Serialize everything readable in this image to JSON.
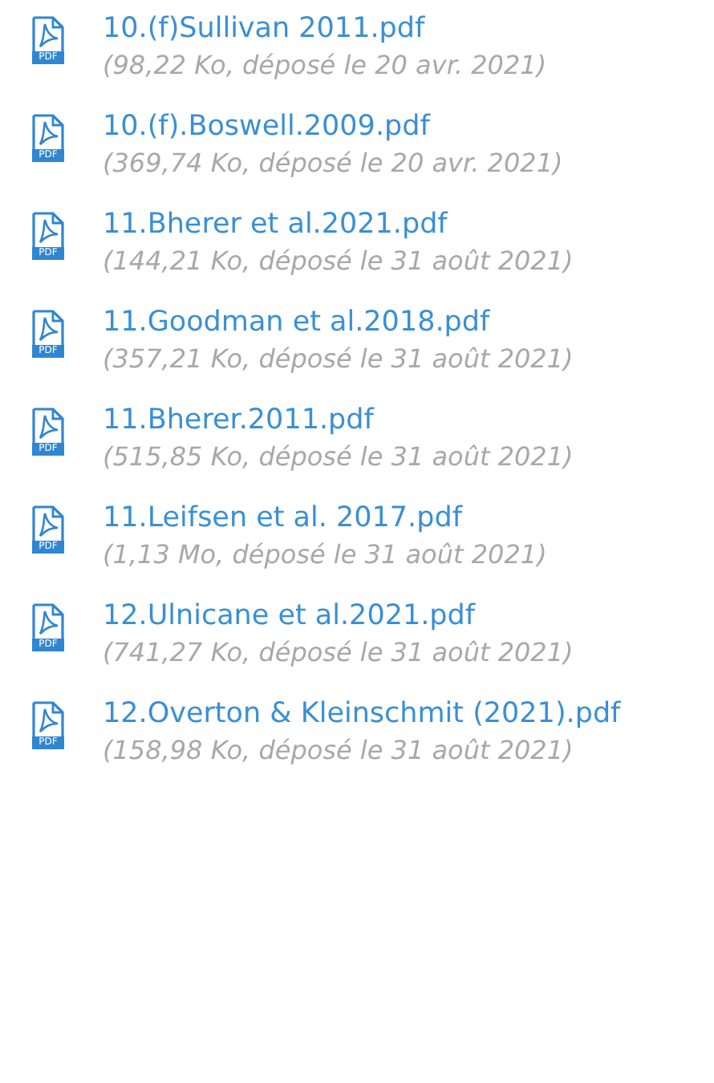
{
  "files": [
    {
      "name": "10.(f)Sullivan 2011.pdf",
      "details": "(98,22 Ko, déposé le 20 avr. 2021)",
      "type_label": "PDF"
    },
    {
      "name": "10.(f).Boswell.2009.pdf",
      "details": "(369,74 Ko, déposé le 20 avr. 2021)",
      "type_label": "PDF"
    },
    {
      "name": "11.Bherer et al.2021.pdf",
      "details": "(144,21 Ko, déposé le 31 août 2021)",
      "type_label": "PDF"
    },
    {
      "name": "11.Goodman et al.2018.pdf",
      "details": "(357,21 Ko, déposé le 31 août 2021)",
      "type_label": "PDF"
    },
    {
      "name": "11.Bherer.2011.pdf",
      "details": "(515,85 Ko, déposé le 31 août 2021)",
      "type_label": "PDF"
    },
    {
      "name": "11.Leifsen et al. 2017.pdf",
      "details": "(1,13 Mo, déposé le 31 août 2021)",
      "type_label": "PDF"
    },
    {
      "name": "12.Ulnicane et al.2021.pdf",
      "details": "(741,27 Ko, déposé le 31 août 2021)",
      "type_label": "PDF"
    },
    {
      "name": "12.Overton & Kleinschmit (2021).pdf",
      "details": "(158,98 Ko, déposé le 31 août 2021)",
      "type_label": "PDF"
    }
  ]
}
